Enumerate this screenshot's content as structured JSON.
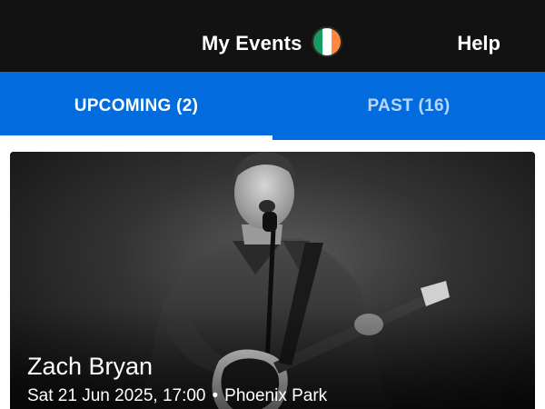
{
  "header": {
    "title": "My Events",
    "help_label": "Help",
    "flag": {
      "icon": "ireland-flag-icon",
      "colors": [
        "#169b62",
        "#ffffff",
        "#ff883e"
      ]
    }
  },
  "tabs": [
    {
      "label": "UPCOMING (2)",
      "selected": true
    },
    {
      "label": "PAST (16)",
      "selected": false
    }
  ],
  "events": [
    {
      "artist": "Zach Bryan",
      "date_time": "Sat 21 Jun 2025, 17:00",
      "separator": "•",
      "venue": "Phoenix Park",
      "image": "performer-with-guitar-photo"
    }
  ],
  "colors": {
    "header_bg": "#121212",
    "tab_bar_bg": "#026cdf",
    "tab_indicator": "#ffffff",
    "card_bg": "#1c1c1c"
  }
}
